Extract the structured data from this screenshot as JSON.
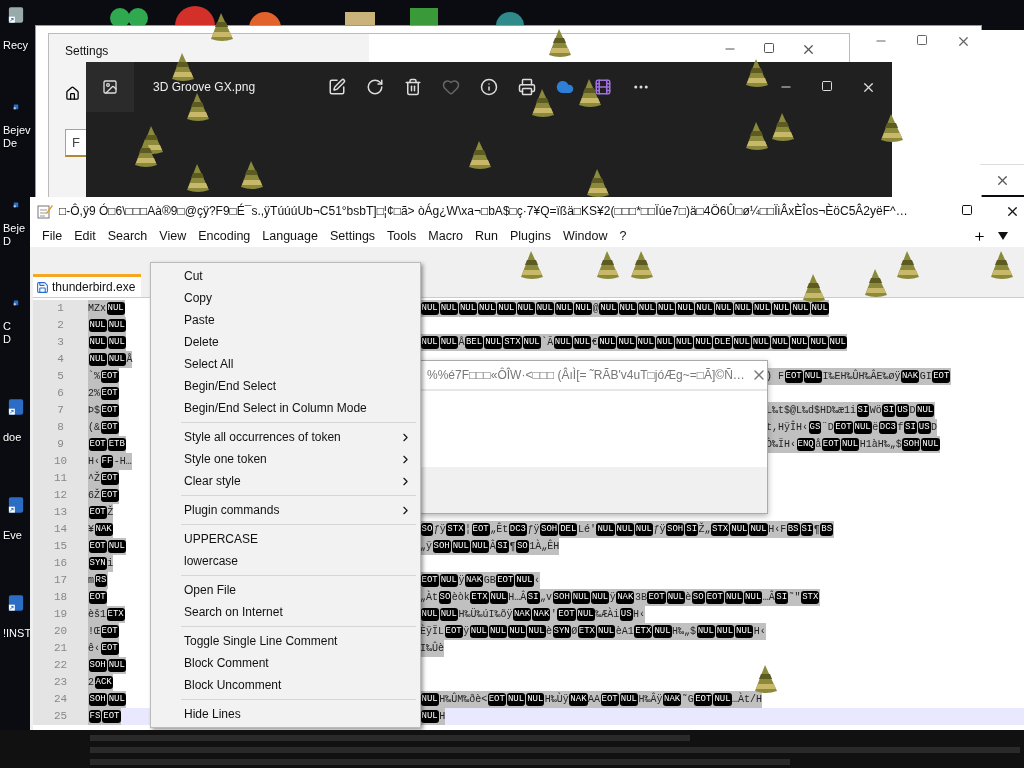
{
  "desktop": {
    "icons": [
      {
        "label_lines": [
          "Recy"
        ]
      },
      {
        "label_lines": [
          "Bejev",
          "De"
        ]
      },
      {
        "label_lines": [
          "Beje",
          "D"
        ]
      },
      {
        "label_lines": [
          "C",
          "D"
        ]
      },
      {
        "label_lines": [
          "doe"
        ]
      },
      {
        "label_lines": [
          "Eve"
        ]
      },
      {
        "label_lines": [
          "!INST"
        ]
      }
    ]
  },
  "settings_window": {
    "title": "Settings",
    "search": {
      "value": "F"
    }
  },
  "photos_window": {
    "title": "3D Groove GX.png"
  },
  "editor_window": {
    "title": "□-Ô,ÿ9 Ó□6\\□□□Aà®9□@çÿ?F9□É¯s.,ÿTúúúUb¬C51°bsbT]□¦¢□ã> òÁg¿W\\xa¬□bA$□ç·7¥Q=ïßä□KS¥2(□□□*□□Ïúe7□)ä□4Ö6Û□ø¼□□ÏiÂxÈÎos¬ÈöC5Â2yëF^…",
    "menu": [
      "File",
      "Edit",
      "Search",
      "View",
      "Encoding",
      "Language",
      "Settings",
      "Tools",
      "Macro",
      "Run",
      "Plugins",
      "Window",
      "?"
    ],
    "tabs": [
      {
        "label": "thunderbird.exe",
        "selected": true
      }
    ],
    "lines": [
      {
        "number": "1",
        "left": [
          {
            "text": "MZx"
          },
          {
            "code": "NUL"
          }
        ],
        "right": [
          {
            "code": "NUL"
          },
          {
            "code": "NUL"
          },
          {
            "code": "NUL"
          },
          {
            "code": "NUL"
          },
          {
            "code": "NUL"
          },
          {
            "code": "NUL"
          },
          {
            "code": "NUL"
          },
          {
            "code": "NUL"
          },
          {
            "code": "NUL"
          },
          {
            "text": "@"
          },
          {
            "code": "NUL"
          },
          {
            "code": "NUL"
          },
          {
            "code": "NUL"
          },
          {
            "code": "NUL"
          },
          {
            "code": "NUL"
          },
          {
            "code": "NUL"
          },
          {
            "code": "NUL"
          },
          {
            "code": "NUL"
          },
          {
            "code": "NUL"
          },
          {
            "code": "NUL"
          },
          {
            "code": "NUL"
          },
          {
            "code": "NUL"
          }
        ]
      },
      {
        "number": "2",
        "left": [
          {
            "code": "NUL"
          },
          {
            "code": "NUL"
          }
        ]
      },
      {
        "number": "3",
        "left": [
          {
            "code": "NUL"
          },
          {
            "code": "NUL"
          }
        ],
        "right": [
          {
            "code": "NUL"
          },
          {
            "code": "NUL"
          },
          {
            "text": "Å"
          },
          {
            "code": "BEL"
          },
          {
            "code": "NUL"
          },
          {
            "code": "STX"
          },
          {
            "code": "NUL"
          },
          {
            "text": "`Ã"
          },
          {
            "code": "NUL"
          },
          {
            "code": "NUL"
          },
          {
            "text": "€"
          },
          {
            "code": "NUL"
          },
          {
            "code": "NUL"
          },
          {
            "code": "NUL"
          },
          {
            "code": "NUL"
          },
          {
            "code": "NUL"
          },
          {
            "code": "NUL"
          },
          {
            "code": "DLE"
          },
          {
            "code": "NUL"
          },
          {
            "code": "NUL"
          },
          {
            "code": "NUL"
          },
          {
            "code": "NUL"
          },
          {
            "code": "NUL"
          },
          {
            "code": "NUL"
          }
        ]
      },
      {
        "number": "4",
        "left": [
          {
            "code": "NUL"
          },
          {
            "code": "NUL"
          },
          {
            "text": "Å"
          }
        ]
      },
      {
        "number": "5",
        "left": [
          {
            "text": "`%"
          },
          {
            "code": "EOT"
          }
        ],
        "right": [
          {
            "text": ") F"
          },
          {
            "code": "EOT"
          },
          {
            "code": "NUL"
          },
          {
            "text": "I‰EH‰ÛH‰ÂE‰øÿ"
          },
          {
            "code": "NAK"
          },
          {
            "text": "GI"
          },
          {
            "code": "EOT"
          }
        ]
      },
      {
        "number": "6",
        "left": [
          {
            "text": "2%"
          },
          {
            "code": "EOT"
          }
        ]
      },
      {
        "number": "7",
        "left": [
          {
            "text": "Þ$"
          },
          {
            "code": "EOT"
          }
        ],
        "right": [
          {
            "text": "L‰t$@L‰d$HD‰æ1i"
          },
          {
            "code": "SI"
          },
          {
            "text": "Wö"
          },
          {
            "code": "SI"
          },
          {
            "code": "US"
          },
          {
            "text": "D"
          },
          {
            "code": "NUL"
          }
        ]
      },
      {
        "number": "8",
        "left": [
          {
            "text": "(&"
          },
          {
            "code": "EOT"
          }
        ],
        "right": [
          {
            "text": "t,HÿÎH‹"
          },
          {
            "code": "GS"
          },
          {
            "text": "¨D"
          },
          {
            "code": "EOT"
          },
          {
            "code": "NUL"
          },
          {
            "text": "ë"
          },
          {
            "code": "DC3"
          },
          {
            "text": "f"
          },
          {
            "code": "SI"
          },
          {
            "code": "US"
          },
          {
            "text": "D"
          }
        ]
      },
      {
        "number": "9",
        "left": [
          {
            "code": "EOT"
          },
          {
            "code": "ETB"
          }
        ],
        "right": [
          {
            "text": "Ò‰ÏH‹"
          },
          {
            "code": "ENQ"
          },
          {
            "text": "å"
          },
          {
            "code": "EOT"
          },
          {
            "code": "NUL"
          },
          {
            "text": "H1àH‰„$"
          },
          {
            "code": "SOH"
          },
          {
            "code": "NUL"
          }
        ]
      },
      {
        "number": "10",
        "left": [
          {
            "text": "H‹"
          },
          {
            "code": "FF"
          },
          {
            "text": "-H…"
          }
        ]
      },
      {
        "number": "11",
        "left": [
          {
            "text": "^Ž"
          },
          {
            "code": "EOT"
          }
        ]
      },
      {
        "number": "12",
        "left": [
          {
            "text": "6Ž"
          },
          {
            "code": "EOT"
          }
        ]
      },
      {
        "number": "13",
        "left": [
          {
            "code": "EOT"
          },
          {
            "text": "Ž"
          }
        ]
      },
      {
        "number": "14",
        "left": [
          {
            "text": "¥"
          },
          {
            "code": "NAK"
          }
        ],
        "right": [
          {
            "code": "SO"
          },
          {
            "text": "ƒÿ"
          },
          {
            "code": "STX"
          },
          {
            "text": "¦"
          },
          {
            "code": "EOT"
          },
          {
            "text": "„Êt"
          },
          {
            "code": "DC3"
          },
          {
            "text": "ƒÿ"
          },
          {
            "code": "SOH"
          },
          {
            "code": "DEL"
          },
          {
            "text": "Lé'"
          },
          {
            "code": "NUL"
          },
          {
            "code": "NUL"
          },
          {
            "code": "NUL"
          },
          {
            "text": "ƒÿ"
          },
          {
            "code": "SOH"
          },
          {
            "code": "SI"
          },
          {
            "text": "Ž„"
          },
          {
            "code": "STX"
          },
          {
            "code": "NUL"
          },
          {
            "code": "NUL"
          },
          {
            "text": "H‹F"
          },
          {
            "code": "BS"
          },
          {
            "code": "SI"
          },
          {
            "text": "¶"
          },
          {
            "code": "BS"
          }
        ]
      },
      {
        "number": "15",
        "left": [
          {
            "code": "EOT"
          },
          {
            "code": "NUL"
          }
        ],
        "right": [
          {
            "text": "„ÿ"
          },
          {
            "code": "SOH"
          },
          {
            "code": "NUL"
          },
          {
            "code": "NUL"
          },
          {
            "text": "Â"
          },
          {
            "code": "SI"
          },
          {
            "text": "¶"
          },
          {
            "code": "SO"
          },
          {
            "text": "1À„ÊH"
          }
        ]
      },
      {
        "number": "16",
        "left": [
          {
            "code": "SYN"
          },
          {
            "text": "i"
          }
        ]
      },
      {
        "number": "17",
        "left": [
          {
            "text": "m"
          },
          {
            "code": "RS"
          }
        ],
        "right": [
          {
            "code": "EOT"
          },
          {
            "code": "NUL"
          },
          {
            "text": "ÿ"
          },
          {
            "code": "NAK"
          },
          {
            "text": "GB"
          },
          {
            "code": "EOT"
          },
          {
            "code": "NUL"
          },
          {
            "text": "‹"
          }
        ]
      },
      {
        "number": "18",
        "left": [
          {
            "code": "EOT"
          }
        ],
        "right": [
          {
            "text": "„Àt"
          },
          {
            "code": "SO"
          },
          {
            "text": "èòk"
          },
          {
            "code": "ETX"
          },
          {
            "code": "NUL"
          },
          {
            "text": "H…Â"
          },
          {
            "code": "SI"
          },
          {
            "text": "„v"
          },
          {
            "code": "SOH"
          },
          {
            "code": "NUL"
          },
          {
            "code": "NUL"
          },
          {
            "text": "ÿ"
          },
          {
            "code": "NAK"
          },
          {
            "text": "3B"
          },
          {
            "code": "EOT"
          },
          {
            "code": "NUL"
          },
          {
            "text": "è"
          },
          {
            "code": "SO"
          },
          {
            "code": "EOT"
          },
          {
            "code": "NUL"
          },
          {
            "code": "NUL"
          },
          {
            "text": "…Â"
          },
          {
            "code": "SI"
          },
          {
            "text": "˜\""
          },
          {
            "code": "STX"
          }
        ]
      },
      {
        "number": "19",
        "left": [
          {
            "text": "èš1"
          },
          {
            "code": "ETX"
          }
        ],
        "right": [
          {
            "code": "NUL"
          },
          {
            "code": "NUL"
          },
          {
            "text": "H‰Ü‰úI‰õÿ"
          },
          {
            "code": "NAK"
          },
          {
            "code": "NAK"
          },
          {
            "text": "'"
          },
          {
            "code": "EOT"
          },
          {
            "code": "NUL"
          },
          {
            "text": "‰ÆÀi"
          },
          {
            "code": "US"
          },
          {
            "text": "H‹"
          }
        ]
      },
      {
        "number": "20",
        "left": [
          {
            "text": "!Œ"
          },
          {
            "code": "EOT"
          }
        ],
        "right": [
          {
            "text": "ÈÿÏL"
          },
          {
            "code": "EOT"
          },
          {
            "text": "ÿ"
          },
          {
            "code": "NUL"
          },
          {
            "code": "NUL"
          },
          {
            "code": "NUL"
          },
          {
            "code": "NUL"
          },
          {
            "text": "è"
          },
          {
            "code": "SYN"
          },
          {
            "text": "Ø"
          },
          {
            "code": "ETX"
          },
          {
            "code": "NUL"
          },
          {
            "text": "èA1"
          },
          {
            "code": "ETX"
          },
          {
            "code": "NUL"
          },
          {
            "text": "H‰„$"
          },
          {
            "code": "NUL"
          },
          {
            "code": "NUL"
          },
          {
            "code": "NUL"
          },
          {
            "text": "H‹"
          }
        ]
      },
      {
        "number": "21",
        "left": [
          {
            "text": "ê‹"
          },
          {
            "code": "EOT"
          }
        ],
        "right": [
          {
            "text": "I‰Ûè"
          }
        ]
      },
      {
        "number": "22",
        "left": [
          {
            "code": "SOH"
          },
          {
            "code": "NUL"
          }
        ]
      },
      {
        "number": "23",
        "left": [
          {
            "text": "2"
          },
          {
            "code": "ACK"
          }
        ]
      },
      {
        "number": "24",
        "left": [
          {
            "code": "SOH"
          },
          {
            "code": "NUL"
          }
        ],
        "right": [
          {
            "code": "NUL"
          },
          {
            "text": "H‰ÛM‰ðè<"
          },
          {
            "code": "EOT"
          },
          {
            "code": "NUL"
          },
          {
            "code": "NUL"
          },
          {
            "text": "H‰Ùÿ"
          },
          {
            "code": "NAK"
          },
          {
            "text": "AA"
          },
          {
            "code": "EOT"
          },
          {
            "code": "NUL"
          },
          {
            "text": "H‰Âÿ"
          },
          {
            "code": "NAK"
          },
          {
            "text": "˜G"
          },
          {
            "code": "EOT"
          },
          {
            "code": "NUL"
          },
          {
            "text": "…Àt/H"
          }
        ]
      },
      {
        "number": "25",
        "left": [
          {
            "code": "FS"
          },
          {
            "code": "EOT"
          }
        ],
        "right": [
          {
            "code": "NUL"
          },
          {
            "text": "H"
          }
        ],
        "current": true
      }
    ]
  },
  "context_menu": {
    "groups": [
      [
        {
          "label": "Cut",
          "submenu": false
        },
        {
          "label": "Copy",
          "submenu": false
        },
        {
          "label": "Paste",
          "submenu": false
        },
        {
          "label": "Delete",
          "submenu": false
        },
        {
          "label": "Select All",
          "submenu": false
        },
        {
          "label": "Begin/End Select",
          "submenu": false
        },
        {
          "label": "Begin/End Select in Column Mode",
          "submenu": false
        }
      ],
      [
        {
          "label": "Style all occurrences of token",
          "submenu": true
        },
        {
          "label": "Style one token",
          "submenu": true
        },
        {
          "label": "Clear style",
          "submenu": true
        }
      ],
      [
        {
          "label": "Plugin commands",
          "submenu": true
        }
      ],
      [
        {
          "label": "UPPERCASE",
          "submenu": false
        },
        {
          "label": "lowercase",
          "submenu": false
        }
      ],
      [
        {
          "label": "Open File",
          "submenu": false
        },
        {
          "label": "Search on Internet",
          "submenu": false
        }
      ],
      [
        {
          "label": "Toggle Single Line Comment",
          "submenu": false
        },
        {
          "label": "Block Comment",
          "submenu": false
        },
        {
          "label": "Block Uncomment",
          "submenu": false
        }
      ],
      [
        {
          "label": "Hide Lines",
          "submenu": false
        }
      ]
    ]
  },
  "dialog": {
    "title": "%%é7F□□□«ÔÎW·<□□□ (ÂıÌ[= ˜RÃB'v4uT□jóÆg~=□Ã]©Ñ…"
  }
}
